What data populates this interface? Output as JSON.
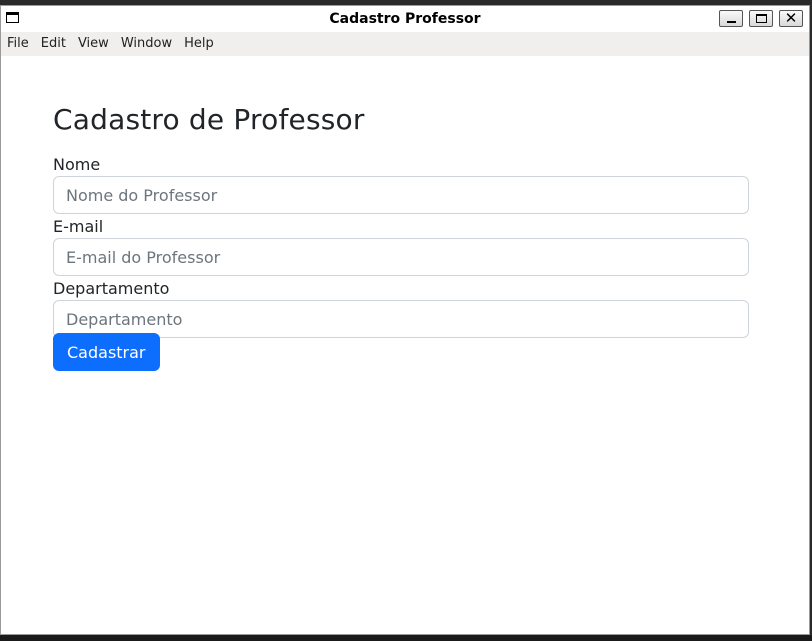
{
  "window": {
    "title": "Cadastro Professor"
  },
  "menu": [
    "File",
    "Edit",
    "View",
    "Window",
    "Help"
  ],
  "form": {
    "heading": "Cadastro de Professor",
    "nome": {
      "label": "Nome",
      "value": "",
      "placeholder": "Nome do Professor"
    },
    "email": {
      "label": "E-mail",
      "value": "",
      "placeholder": "E-mail do Professor"
    },
    "departamento": {
      "label": "Departamento",
      "value": "",
      "placeholder": "Departamento"
    },
    "submit_label": "Cadastrar"
  },
  "colors": {
    "primary": "#0d6efd",
    "text": "#212529",
    "placeholder": "#6c757d",
    "border": "#ced4da"
  },
  "icons": {
    "window": "window-icon",
    "minimize": "minimize-icon",
    "maximize": "maximize-icon",
    "close": "close-icon"
  }
}
